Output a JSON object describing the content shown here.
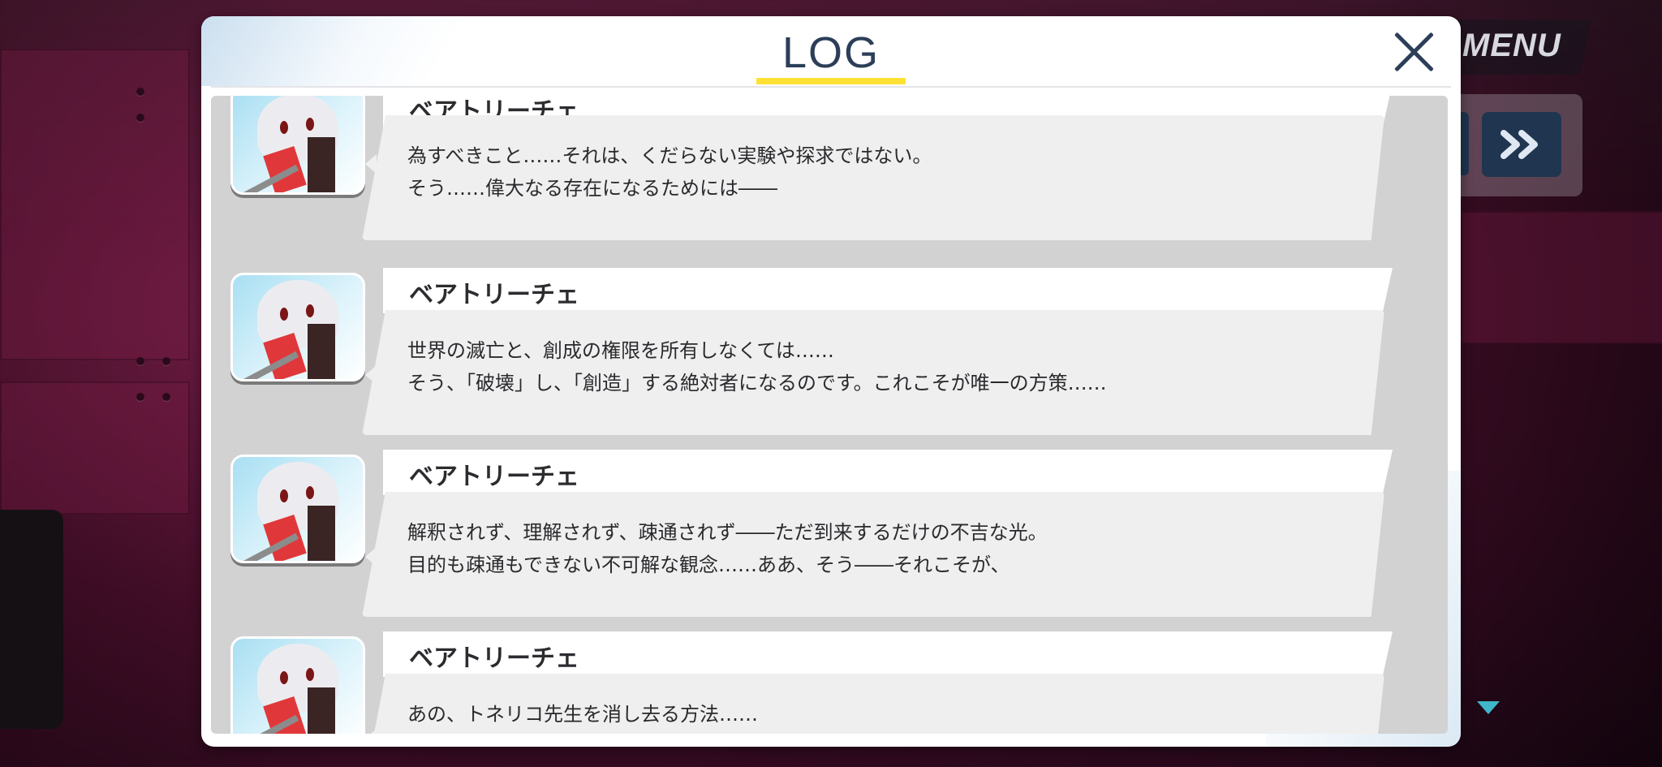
{
  "hud": {
    "menu_label": "MENU"
  },
  "log": {
    "title": "LOG",
    "accent_color": "#ffe135",
    "entries": [
      {
        "speaker": "ベアトリーチェ",
        "lines": [
          "為すべきこと……それは、くだらない実験や探求ではない。",
          "そう……偉大なる存在になるためには――"
        ]
      },
      {
        "speaker": "ベアトリーチェ",
        "lines": [
          "世界の滅亡と、創成の権限を所有しなくては……",
          "そう、「破壊」し、「創造」する絶対者になるのです。これこそが唯一の方策……"
        ]
      },
      {
        "speaker": "ベアトリーチェ",
        "lines": [
          "解釈されず、理解されず、疎通されず――ただ到来するだけの不吉な光。",
          "目的も疎通もできない不可解な観念……ああ、そう――それこそが、"
        ]
      },
      {
        "speaker": "ベアトリーチェ",
        "lines": [
          "あの、トネリコ先生を消し去る方法……"
        ]
      }
    ]
  },
  "icons": {
    "close": "close-icon",
    "fast_forward": "fast-forward-icon",
    "scroll_down": "triangle-down-icon"
  }
}
